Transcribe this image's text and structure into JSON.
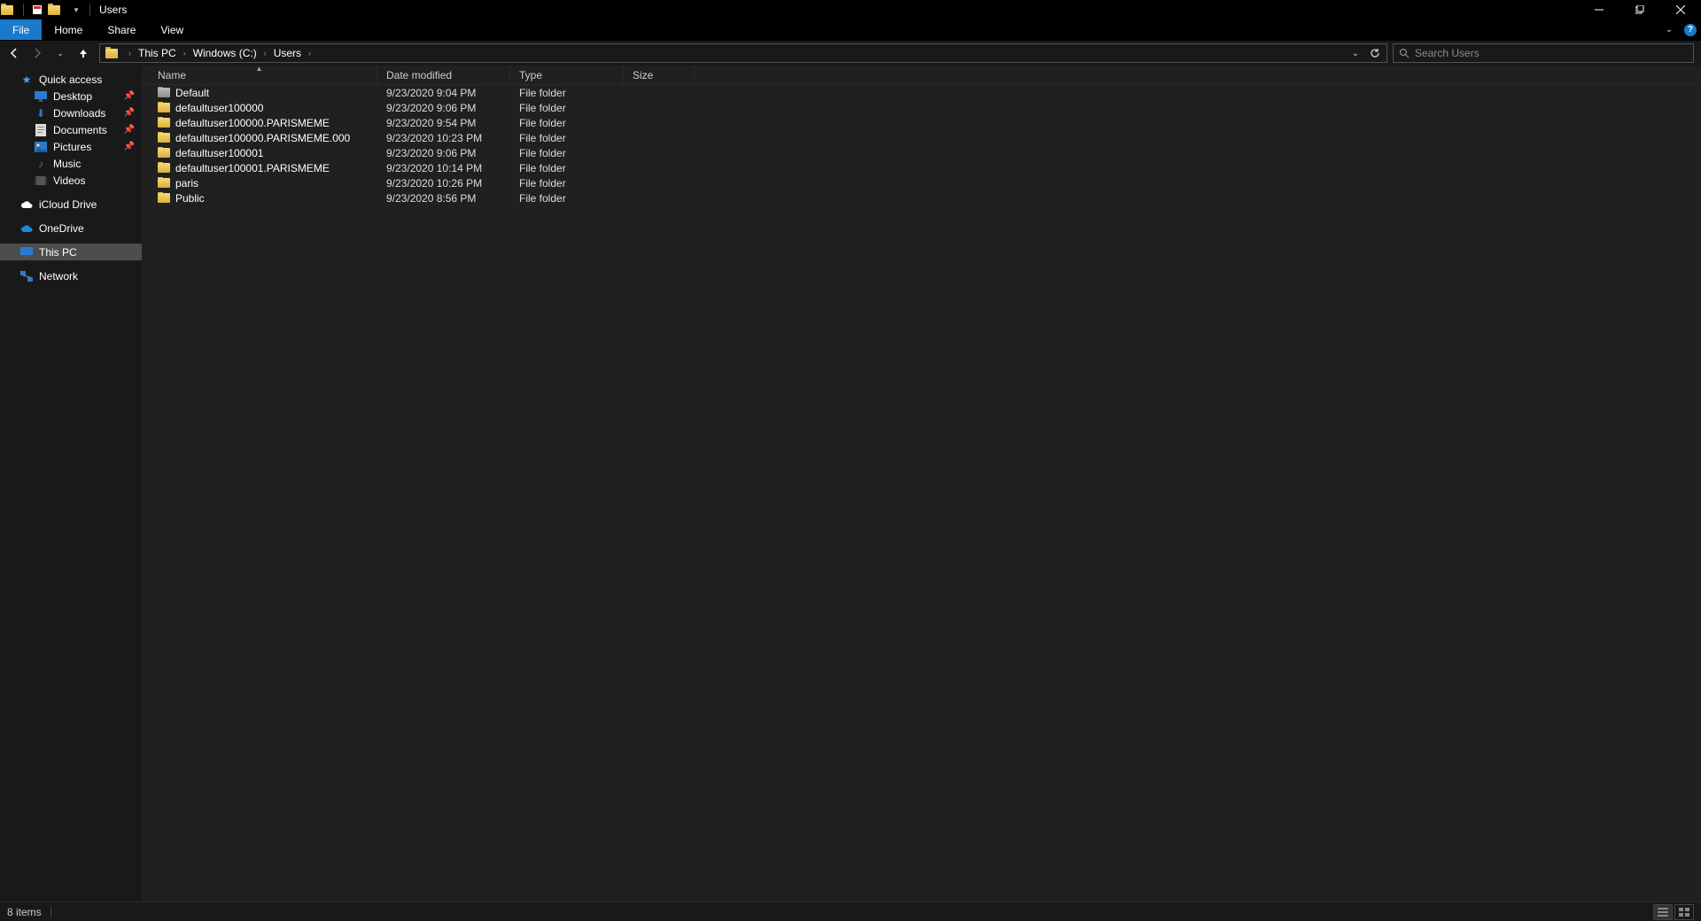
{
  "window": {
    "title": "Users"
  },
  "ribbon": {
    "tabs": {
      "file": "File",
      "home": "Home",
      "share": "Share",
      "view": "View"
    }
  },
  "breadcrumb": {
    "segments": [
      "This PC",
      "Windows (C:)",
      "Users"
    ]
  },
  "search": {
    "placeholder": "Search Users"
  },
  "sidebar": {
    "quick_access": {
      "label": "Quick access",
      "items": [
        {
          "label": "Desktop",
          "pinned": true
        },
        {
          "label": "Downloads",
          "pinned": true
        },
        {
          "label": "Documents",
          "pinned": true
        },
        {
          "label": "Pictures",
          "pinned": true
        },
        {
          "label": "Music",
          "pinned": false
        },
        {
          "label": "Videos",
          "pinned": false
        }
      ]
    },
    "icloud": {
      "label": "iCloud Drive"
    },
    "onedrive": {
      "label": "OneDrive"
    },
    "thispc": {
      "label": "This PC"
    },
    "network": {
      "label": "Network"
    }
  },
  "columns": {
    "name": "Name",
    "date": "Date modified",
    "type": "Type",
    "size": "Size"
  },
  "rows": [
    {
      "name": "Default",
      "date": "9/23/2020 9:04 PM",
      "type": "File folder",
      "icon": "grey"
    },
    {
      "name": "defaultuser100000",
      "date": "9/23/2020 9:06 PM",
      "type": "File folder",
      "icon": "yellow"
    },
    {
      "name": "defaultuser100000.PARISMEME",
      "date": "9/23/2020 9:54 PM",
      "type": "File folder",
      "icon": "yellow"
    },
    {
      "name": "defaultuser100000.PARISMEME.000",
      "date": "9/23/2020 10:23 PM",
      "type": "File folder",
      "icon": "yellow"
    },
    {
      "name": "defaultuser100001",
      "date": "9/23/2020 9:06 PM",
      "type": "File folder",
      "icon": "yellow"
    },
    {
      "name": "defaultuser100001.PARISMEME",
      "date": "9/23/2020 10:14 PM",
      "type": "File folder",
      "icon": "yellow"
    },
    {
      "name": "paris",
      "date": "9/23/2020 10:26 PM",
      "type": "File folder",
      "icon": "yellow"
    },
    {
      "name": "Public",
      "date": "9/23/2020 8:56 PM",
      "type": "File folder",
      "icon": "yellow"
    }
  ],
  "status": {
    "count_label": "8 items"
  }
}
